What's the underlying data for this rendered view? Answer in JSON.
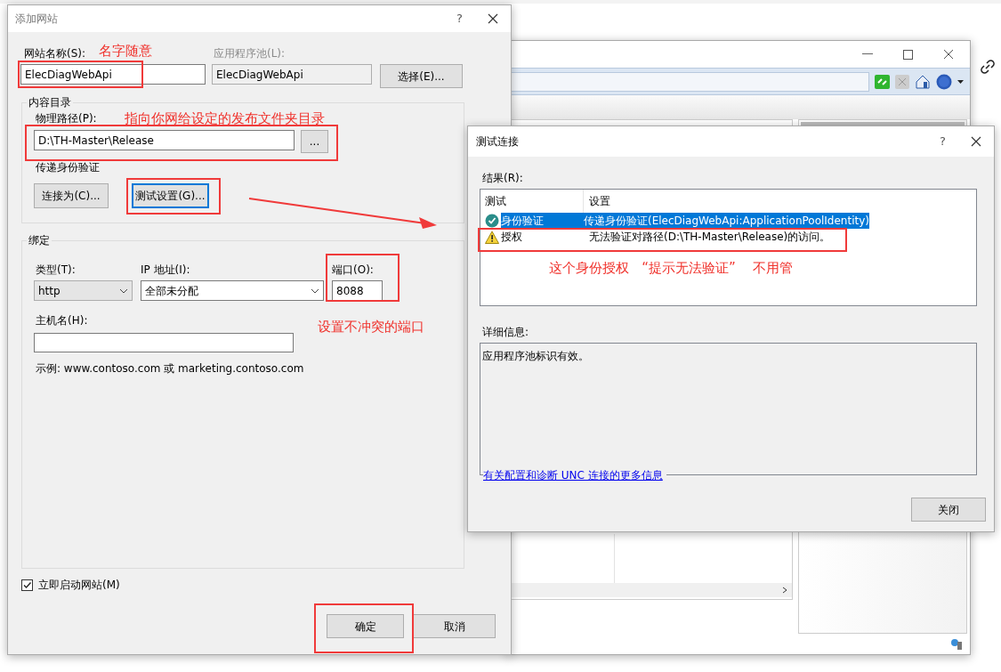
{
  "add_site_dialog": {
    "title": "添加网站",
    "help": "?",
    "site_name_label": "网站名称(S):",
    "site_name": "ElecDiagWebApi",
    "app_pool_label": "应用程序池(L):",
    "app_pool": "ElecDiagWebApi",
    "select_button": "选择(E)...",
    "content_group": "内容目录",
    "physical_path_label": "物理路径(P):",
    "physical_path": "D:\\TH-Master\\Release",
    "browse_button": "...",
    "passthrough_label": "传递身份验证",
    "connect_as_button": "连接为(C)...",
    "test_settings_button": "测试设置(G)...",
    "test_settings_focused": true,
    "binding_group": "绑定",
    "type_label": "类型(T):",
    "type": "http",
    "ip_label": "IP 地址(I):",
    "ip": "全部未分配",
    "port_label": "端口(O):",
    "port": "8088",
    "hostname_label": "主机名(H):",
    "example": "示例: www.contoso.com 或 marketing.contoso.com",
    "start_checkbox": {
      "label": "立即启动网站(M)",
      "checked": true
    },
    "ok_button": "确定",
    "cancel_button": "取消"
  },
  "test_dialog": {
    "title": "测试连接",
    "help": "?",
    "results_label": "结果(R):",
    "columns": [
      "测试",
      "设置"
    ],
    "rows": [
      {
        "test": "身份验证",
        "setting": "传递身份验证(ElecDiagWebApi:ApplicationPoolIdentity)",
        "kind": "ok",
        "selected": true
      },
      {
        "test": "授权",
        "setting": "无法验证对路径(D:\\TH-Master\\Release)的访问。",
        "kind": "warning",
        "selected": false
      }
    ],
    "details_label": "详细信息:",
    "details": "应用程序池标识有效。",
    "more_info_link": "有关配置和诊断 UNC 连接的更多信息",
    "close_button": "关闭"
  },
  "annotations": [
    {
      "text": "名字随意"
    },
    {
      "text": "指向你网给设定的发布文件夹目录"
    },
    {
      "text": "设置不冲突的端口"
    },
    {
      "text": "这个身份授权   “提示无法验证”    不用管"
    }
  ]
}
